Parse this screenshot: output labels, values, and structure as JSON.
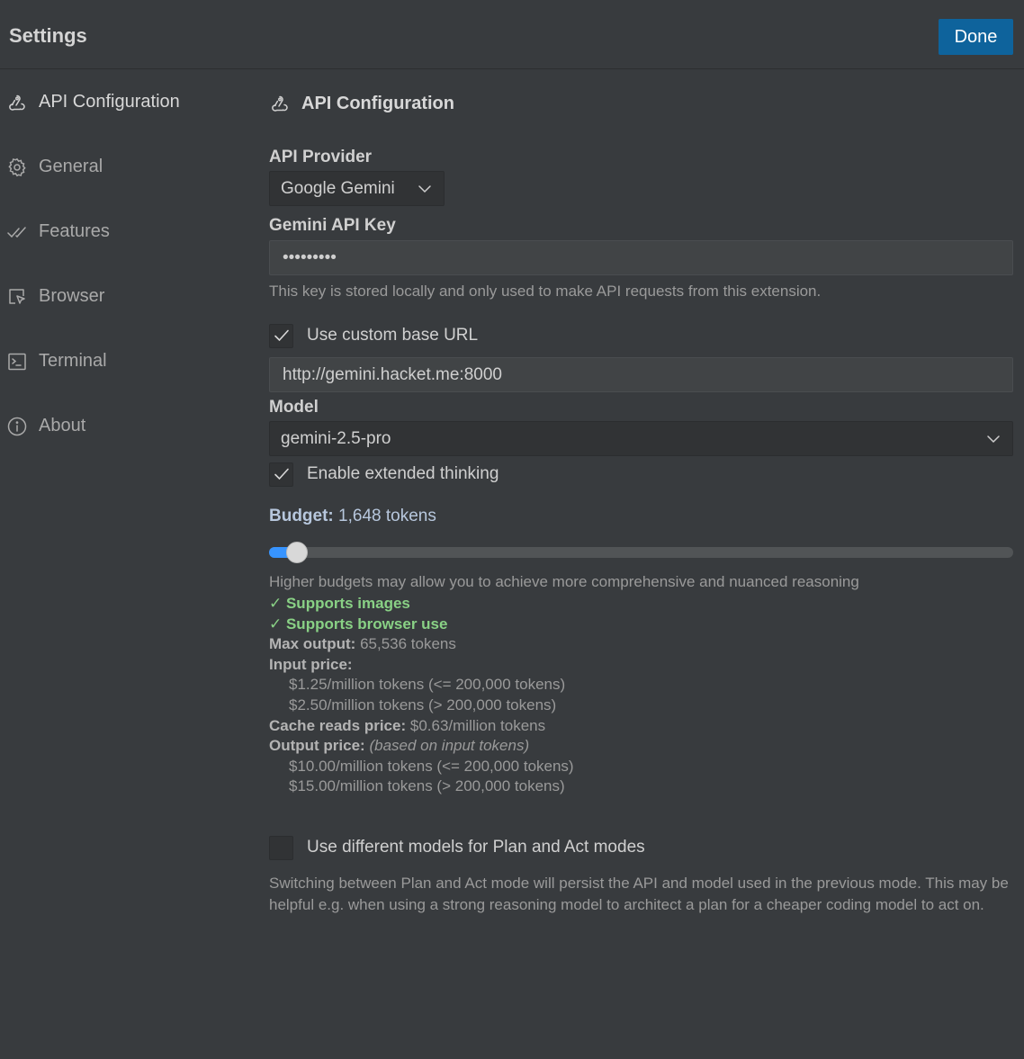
{
  "header": {
    "title": "Settings",
    "done_label": "Done"
  },
  "sidebar": {
    "items": [
      {
        "label": "API Configuration",
        "icon": "webhook-icon",
        "active": true
      },
      {
        "label": "General",
        "icon": "gear-icon"
      },
      {
        "label": "Features",
        "icon": "check-double-icon"
      },
      {
        "label": "Browser",
        "icon": "browser-cursor-icon"
      },
      {
        "label": "Terminal",
        "icon": "terminal-icon"
      },
      {
        "label": "About",
        "icon": "info-icon"
      }
    ]
  },
  "main": {
    "section_title": "API Configuration",
    "provider": {
      "label": "API Provider",
      "value": "Google Gemini"
    },
    "api_key": {
      "label": "Gemini API Key",
      "value": "•••••••••",
      "description": "This key is stored locally and only used to make API requests from this extension."
    },
    "custom_base_url": {
      "label": "Use custom base URL",
      "checked": true,
      "value": "http://gemini.hacket.me:8000"
    },
    "model": {
      "label": "Model",
      "value": "gemini-2.5-pro"
    },
    "extended_thinking": {
      "label": "Enable extended thinking",
      "checked": true
    },
    "budget": {
      "label": "Budget:",
      "value_text": "1,648 tokens",
      "fraction": 0.026,
      "description": "Higher budgets may allow you to achieve more comprehensive and nuanced reasoning"
    },
    "model_info": {
      "supports_images": "✓ Supports images",
      "supports_browser": "✓ Supports browser use",
      "max_output_label": "Max output:",
      "max_output_value": "65,536 tokens",
      "input_price_label": "Input price:",
      "input_price_1": "$1.25/million tokens (<= 200,000 tokens)",
      "input_price_2": "$2.50/million tokens (> 200,000 tokens)",
      "cache_reads_label": "Cache reads price:",
      "cache_reads_value": "$0.63/million tokens",
      "output_price_label": "Output price:",
      "output_price_note": "(based on input tokens)",
      "output_price_1": "$10.00/million tokens (<= 200,000 tokens)",
      "output_price_2": "$15.00/million tokens (> 200,000 tokens)"
    },
    "plan_act": {
      "label": "Use different models for Plan and Act modes",
      "checked": false,
      "description": "Switching between Plan and Act mode will persist the API and model used in the previous mode. This may be helpful e.g. when using a strong reasoning model to architect a plan for a cheaper coding model to act on."
    }
  },
  "colors": {
    "accent": "#0e639c",
    "slider_fill": "#3794ff",
    "success": "#89d185",
    "background": "#383b3e"
  }
}
